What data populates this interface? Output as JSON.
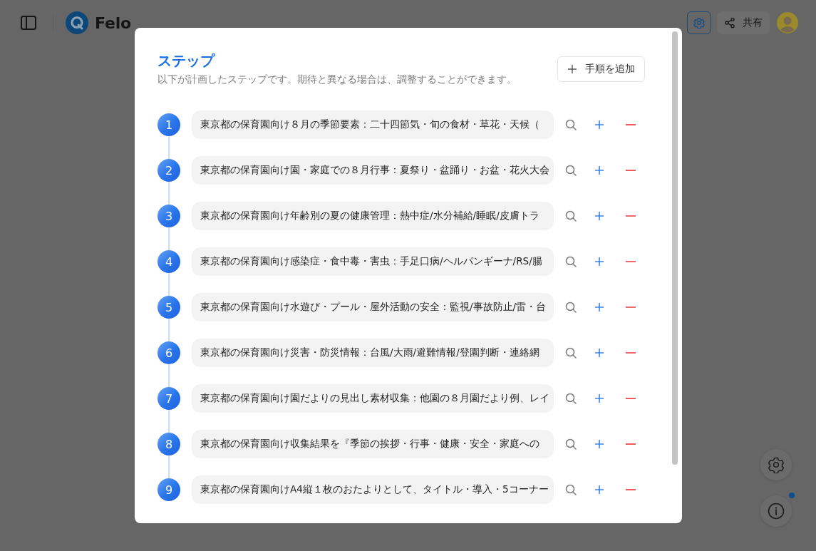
{
  "header": {
    "brand": "Felo",
    "settings_active": true,
    "share_label": "共有"
  },
  "dialog": {
    "title": "ステップ",
    "subtitle": "以下が計画したステップです。期待と異なる場合は、調整することができます。",
    "add_button": "手順を追加",
    "steps": [
      {
        "number": "1",
        "text": "東京都の保育園向け８月の季節要素：二十四節気・旬の食材・草花・天候（"
      },
      {
        "number": "2",
        "text": "東京都の保育園向け園・家庭での８月行事：夏祭り・盆踊り・お盆・花火大会"
      },
      {
        "number": "3",
        "text": "東京都の保育園向け年齢別の夏の健康管理：熱中症/水分補給/睡眠/皮膚トラ"
      },
      {
        "number": "4",
        "text": "東京都の保育園向け感染症・食中毒・害虫：手足口病/ヘルパンギーナ/RS/腸"
      },
      {
        "number": "5",
        "text": "東京都の保育園向け水遊び・プール・屋外活動の安全：監視/事故防止/雷・台"
      },
      {
        "number": "6",
        "text": "東京都の保育園向け災害・防災情報：台風/大雨/避難情報/登園判断・連絡網"
      },
      {
        "number": "7",
        "text": "東京都の保育園向け園だよりの見出し素材収集：他園の８月園だより例、レイ"
      },
      {
        "number": "8",
        "text": "東京都の保育園向け収集結果を『季節の挨拶・行事・健康・安全・家庭への"
      },
      {
        "number": "9",
        "text": "東京都の保育園向けA4縦１枚のおたよりとして、タイトル・導入・5コーナー"
      }
    ]
  },
  "floating": {
    "info_notification": true
  }
}
